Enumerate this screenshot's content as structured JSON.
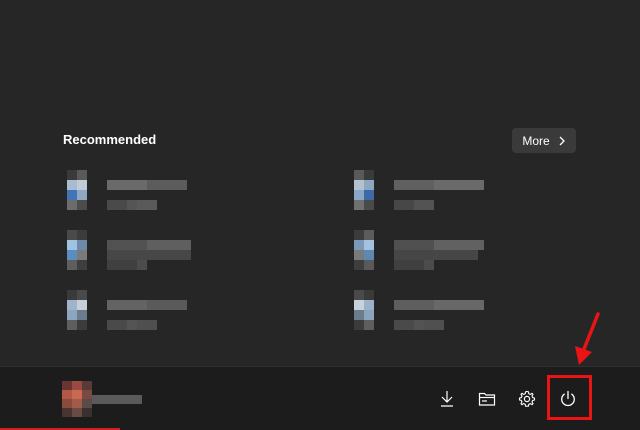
{
  "recommended": {
    "title": "Recommended",
    "more_label": "More"
  },
  "bottom_bar": {
    "buttons": [
      {
        "name": "downloads",
        "icon": "download-icon"
      },
      {
        "name": "file-explorer",
        "icon": "folder-icon"
      },
      {
        "name": "settings",
        "icon": "gear-icon"
      },
      {
        "name": "power",
        "icon": "power-icon"
      }
    ]
  },
  "colors": {
    "background": "#262626",
    "highlight": "#ea1414",
    "text": "#ffffff"
  }
}
